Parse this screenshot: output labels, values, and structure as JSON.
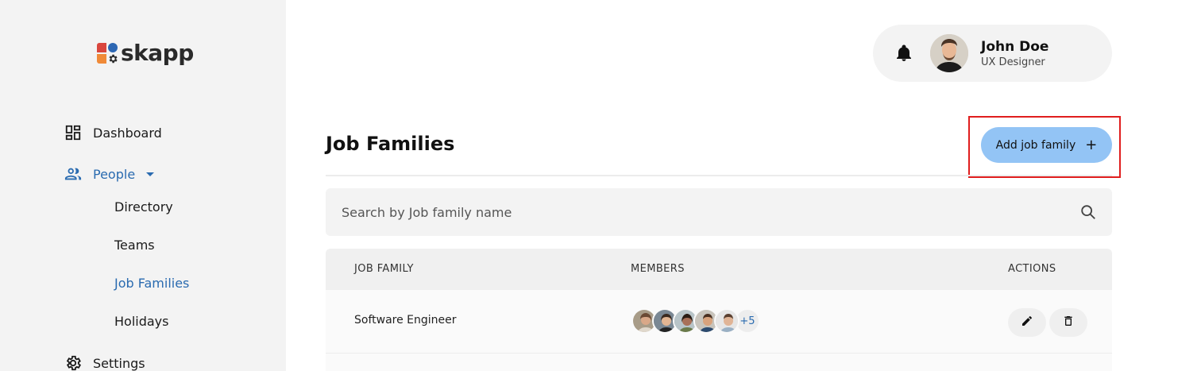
{
  "app": {
    "logo_text": "skapp"
  },
  "sidebar": {
    "items": [
      {
        "label": "Dashboard",
        "icon": "dashboard-icon"
      },
      {
        "label": "People",
        "icon": "people-icon",
        "expanded": true
      },
      {
        "label": "Settings",
        "icon": "gear-icon"
      }
    ],
    "people_sub": [
      "Directory",
      "Teams",
      "Job Families",
      "Holidays"
    ],
    "active_sub": "Job Families"
  },
  "header": {
    "user_name": "John Doe",
    "user_role": "UX Designer"
  },
  "main": {
    "title": "Job Families",
    "add_button_label": "Add job family",
    "search_placeholder": "Search by Job family name",
    "table": {
      "columns": [
        "JOB FAMILY",
        "MEMBERS",
        "ACTIONS"
      ],
      "rows": [
        {
          "name": "Software Engineer",
          "members_more": "+5"
        }
      ]
    }
  },
  "colors": {
    "accent": "#2a6bb0",
    "button": "#93c4f5",
    "highlight": "#e01e1e",
    "sidebar_bg": "#f3f3f3"
  }
}
